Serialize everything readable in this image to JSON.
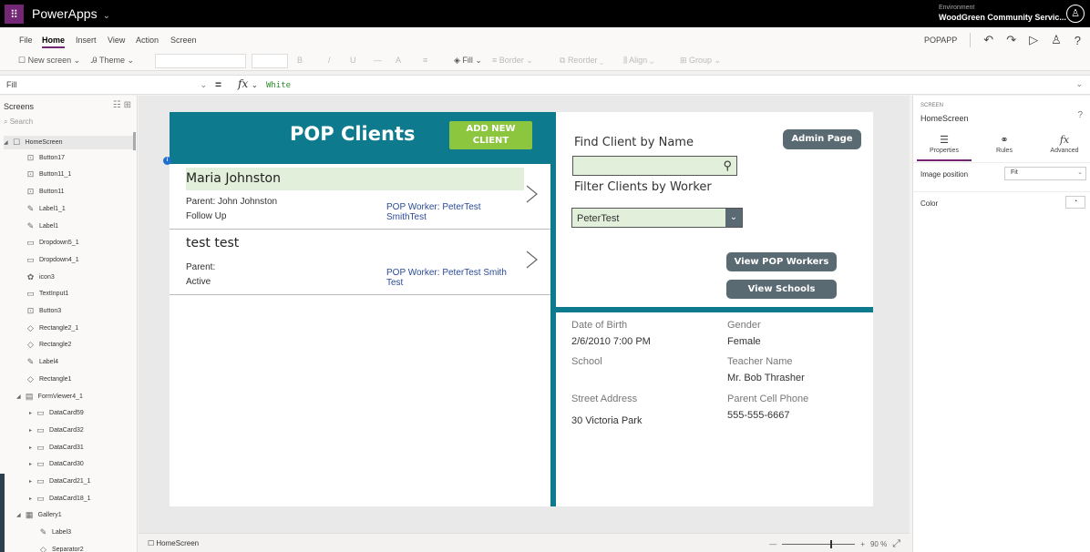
{
  "topbar": {
    "app_name": "PowerApps",
    "env_label": "Environment",
    "env_name": "WoodGreen Community Servic..."
  },
  "menu": {
    "items": [
      "File",
      "Home",
      "Insert",
      "View",
      "Action",
      "Screen"
    ],
    "active": "Home",
    "app_label": "POPAPP"
  },
  "toolbar": {
    "new_screen": "New screen",
    "theme": "Theme",
    "bold": "B",
    "italic": "/",
    "underline": "U",
    "strike": "—",
    "font_size": "A",
    "align_text": "≡",
    "fill": "Fill",
    "border": "Border",
    "reorder": "Reorder",
    "align": "Align",
    "group": "Group"
  },
  "formula": {
    "property": "Fill",
    "equals": "=",
    "fx": "fx",
    "value": "White"
  },
  "tree": {
    "header": "Screens",
    "search_placeholder": "Search",
    "nodes": [
      {
        "label": "HomeScreen",
        "indent": 0,
        "icon": "☐",
        "expander": "◢"
      },
      {
        "label": "Button17",
        "indent": 1,
        "icon": "⊡"
      },
      {
        "label": "Button11_1",
        "indent": 1,
        "icon": "⊡"
      },
      {
        "label": "Button11",
        "indent": 1,
        "icon": "⊡"
      },
      {
        "label": "Label1_1",
        "indent": 1,
        "icon": "✎"
      },
      {
        "label": "Label1",
        "indent": 1,
        "icon": "✎"
      },
      {
        "label": "Dropdown5_1",
        "indent": 1,
        "icon": "▭"
      },
      {
        "label": "Dropdown4_1",
        "indent": 1,
        "icon": "▭"
      },
      {
        "label": "icon3",
        "indent": 1,
        "icon": "✿"
      },
      {
        "label": "TextInput1",
        "indent": 1,
        "icon": "▭"
      },
      {
        "label": "Button3",
        "indent": 1,
        "icon": "⊡"
      },
      {
        "label": "Rectangle2_1",
        "indent": 1,
        "icon": "◇"
      },
      {
        "label": "Rectangle2",
        "indent": 1,
        "icon": "◇"
      },
      {
        "label": "Label4",
        "indent": 1,
        "icon": "✎"
      },
      {
        "label": "Rectangle1",
        "indent": 1,
        "icon": "◇"
      },
      {
        "label": "FormViewer4_1",
        "indent": 1,
        "icon": "▤",
        "expander": "◢"
      },
      {
        "label": "DataCard59",
        "indent": 2,
        "icon": "▭",
        "expander": "▸"
      },
      {
        "label": "DataCard32",
        "indent": 2,
        "icon": "▭",
        "expander": "▸"
      },
      {
        "label": "DataCard31",
        "indent": 2,
        "icon": "▭",
        "expander": "▸"
      },
      {
        "label": "DataCard30",
        "indent": 2,
        "icon": "▭",
        "expander": "▸"
      },
      {
        "label": "DataCard21_1",
        "indent": 2,
        "icon": "▭",
        "expander": "▸"
      },
      {
        "label": "DataCard18_1",
        "indent": 2,
        "icon": "▭",
        "expander": "▸"
      },
      {
        "label": "Gallery1",
        "indent": 1,
        "icon": "▦",
        "expander": "◢"
      },
      {
        "label": "Label3",
        "indent": 2,
        "icon": "✎"
      },
      {
        "label": "Separator2",
        "indent": 2,
        "icon": "◇"
      }
    ]
  },
  "status": {
    "screen": "HomeScreen",
    "zoom_minus": "—",
    "zoom_plus": "+",
    "zoom_value": "90 %"
  },
  "app": {
    "title": "POP Clients",
    "add_button": "ADD NEW CLIENT",
    "clients": [
      {
        "name": "Maria Johnston",
        "parent": "Parent: John Johnston",
        "status": "Follow Up",
        "worker": "POP Worker: PeterTest SmithTest"
      },
      {
        "name": "test test",
        "parent": "Parent:",
        "status": "Active",
        "worker": "POP Worker: PeterTest Smith Test"
      }
    ],
    "find_label": "Find Client by Name",
    "admin_button": "Admin Page",
    "filter_label": "Filter Clients by Worker",
    "dropdown_value": "PeterTest",
    "view_workers": "View POP Workers",
    "view_schools": "View Schools",
    "details": {
      "dob_label": "Date of Birth",
      "dob": "2/6/2010 7:00 PM",
      "gender_label": "Gender",
      "gender": "Female",
      "school_label": "School",
      "school": "",
      "teacher_label": "Teacher Name",
      "teacher": "Mr. Bob Thrasher",
      "address_label": "Street Address",
      "address": "30 Victoria Park",
      "phone_label": "Parent Cell Phone",
      "phone": "555-555-6667"
    }
  },
  "props": {
    "kind": "SCREEN",
    "name": "HomeScreen",
    "tabs": [
      "Properties",
      "Rules",
      "Advanced"
    ],
    "image_position_label": "Image position",
    "image_position_value": "Fit",
    "color_label": "Color"
  },
  "colors": {
    "teal": "#0d7a8e",
    "green_button": "#8cc63f",
    "slate_button": "#5a6a72",
    "highlight": "#e2efda",
    "purple": "#742774"
  }
}
